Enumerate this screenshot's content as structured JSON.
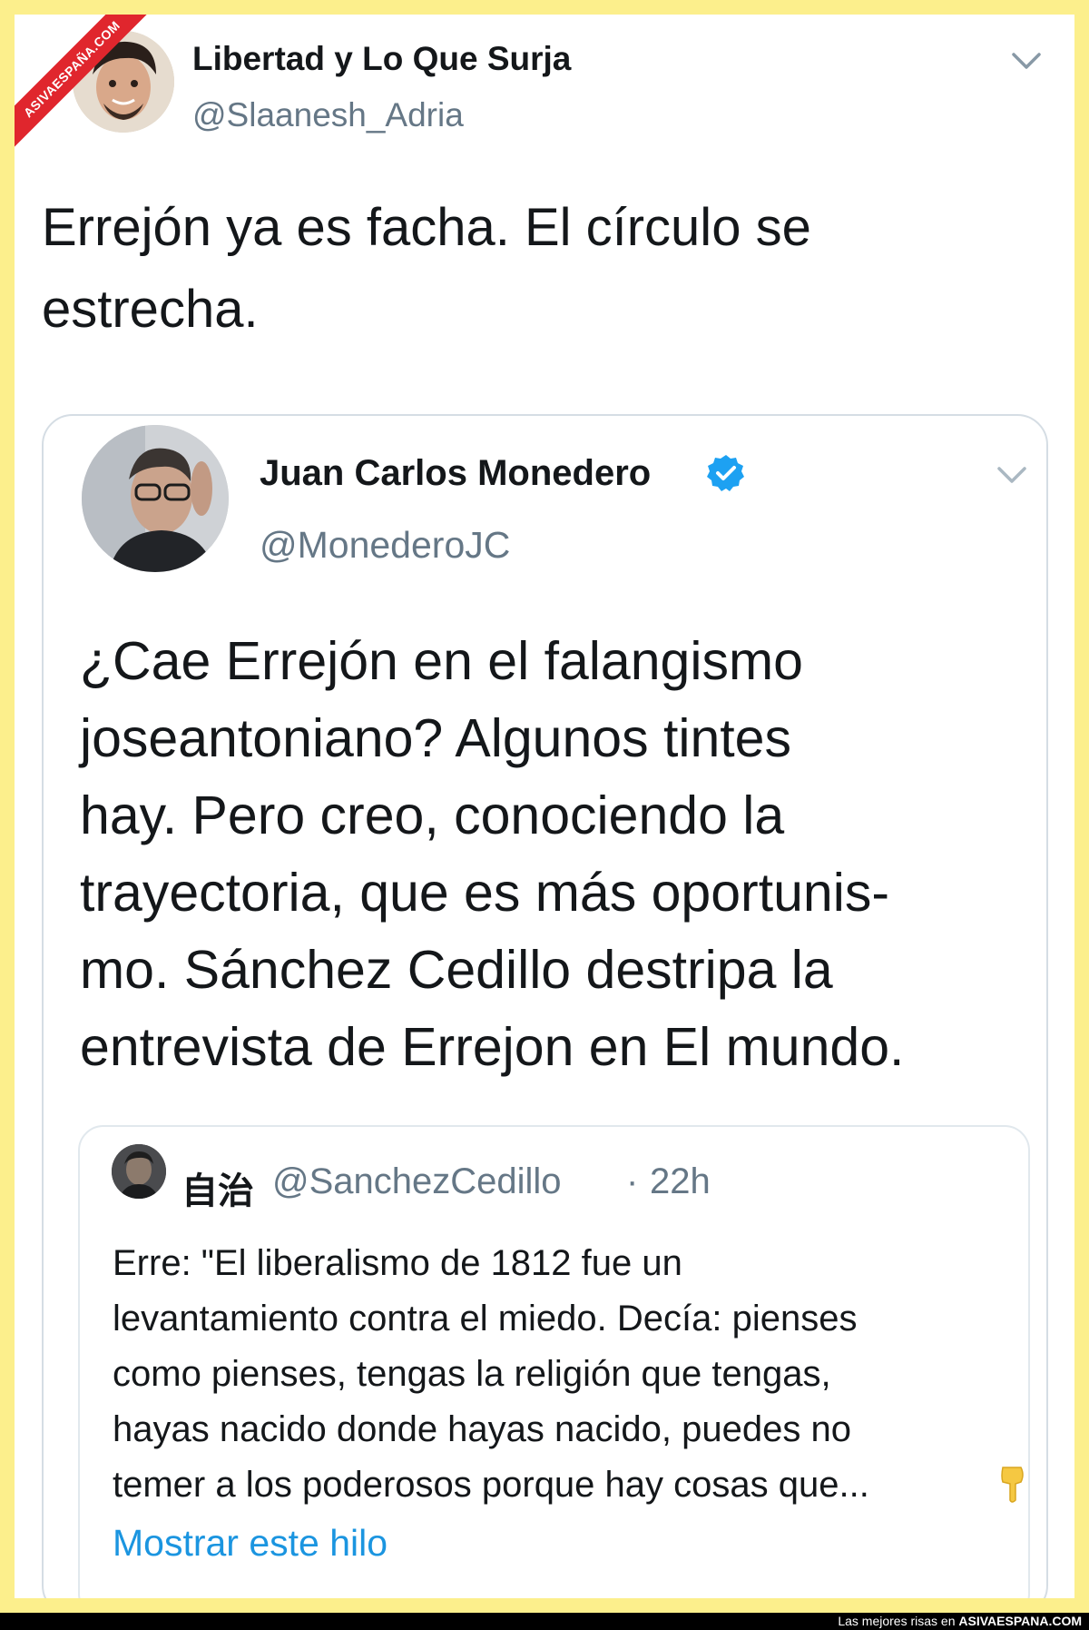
{
  "watermark": {
    "text": "ASIVAESPAÑA.COM"
  },
  "tweet": {
    "author_name": "Libertad y Lo Que Surja",
    "author_handle": "@Slaanesh_Adria",
    "text_line1": "Errejón ya es facha. El círculo se",
    "text_line2": "estrecha."
  },
  "quoted_tweet": {
    "author_name": "Juan Carlos Monedero",
    "author_handle": "@MonederoJC",
    "verified_color": "#1da1f2",
    "lines": [
      "¿Cae Errejón en el falangismo",
      "joseantoniano? Algunos tintes",
      "hay. Pero creo, conociendo la",
      "trayectoria, que es más oportunis-",
      "mo. Sánchez Cedillo destripa la",
      "entrevista de Errejon en El mundo."
    ]
  },
  "nested_quote": {
    "author_name": "自治",
    "author_handle": "@SanchezCedillo",
    "separator": "·",
    "time": "22h",
    "lines": [
      "Erre: \"El liberalismo de 1812 fue un",
      "levantamiento contra el miedo. Decía: pienses",
      "como pienses, tengas la religión que tengas,",
      "hayas nacido donde hayas nacido, puedes no",
      "temer a los poderosos porque hay cosas que..."
    ],
    "emoji_icon": "pointing-down-hand-icon",
    "show_thread": "Mostrar este hilo"
  },
  "footer": {
    "prefix": "Las mejores risas en",
    "site": "ASIVAESPANA.COM"
  },
  "colors": {
    "background": "#fcef8c",
    "link": "#1b95e0",
    "ribbon": "#e0262d"
  }
}
